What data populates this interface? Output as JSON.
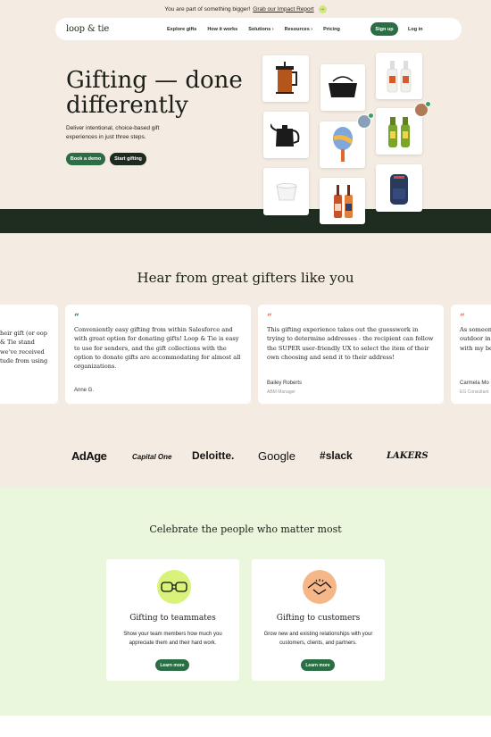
{
  "announcement": {
    "text": "You are part of something bigger!",
    "link": "Grab our Impact Report",
    "icon": "arrow-right-icon"
  },
  "nav": {
    "logo": "loop & tie",
    "links": [
      "Explore gifts",
      "How it works",
      "Solutions ›",
      "Resources ›",
      "Pricing"
    ],
    "signup": "Sign up",
    "login": "Log in"
  },
  "hero": {
    "title_line1": "Gifting — done",
    "title_line2": "differently",
    "subtitle": "Deliver intentional, choice-based gift experiences in just three steps.",
    "book_demo": "Book a demo",
    "start_gifting": "Start gifting"
  },
  "testimonials": {
    "title": "Hear from great gifters like you",
    "items": [
      {
        "text": "heir gift (or oop & Tie stand we've received tude from using",
        "name": "",
        "role": ""
      },
      {
        "text": "Conveniently easy gifting from within Salesforce and with great option for donating gifts! Loop & Tie is easy to use for senders, and the gift collections with the option to donate gifts are accommodating for almost all organizations.",
        "name": "Anne G.",
        "role": ""
      },
      {
        "text": "This gifting experience takes out the guesswork in trying to determine addresses - the recipient can follow the SUPER user-friendly UX to select the item of their own choosing and send it to their address!",
        "name": "Bailey Roberts",
        "role": "ABM Manager"
      },
      {
        "text": "As someon outdoor in with my be",
        "name": "Carmela Mo",
        "role": "EG Consultant"
      }
    ]
  },
  "logos": [
    "AdAge",
    "Capital One",
    "Deloitte.",
    "Google",
    "slack",
    "LAKERS"
  ],
  "celebrate": {
    "title": "Celebrate the people who matter most",
    "cards": [
      {
        "title": "Gifting to teammates",
        "desc": "Show your team members how much you appreciate them and their hard work.",
        "button": "Learn more",
        "icon": "fist-bump-icon"
      },
      {
        "title": "Gifting to customers",
        "desc": "Grow new and existing relationships with your customers, clients, and partners.",
        "button": "Learn more",
        "icon": "handshake-icon"
      }
    ]
  },
  "colors": {
    "brand_green": "#2b6e45",
    "dark": "#1e2d20",
    "cream": "#f4ece2",
    "mint": "#eaf7dc",
    "lime": "#d9f27a",
    "peach": "#f6b788"
  }
}
